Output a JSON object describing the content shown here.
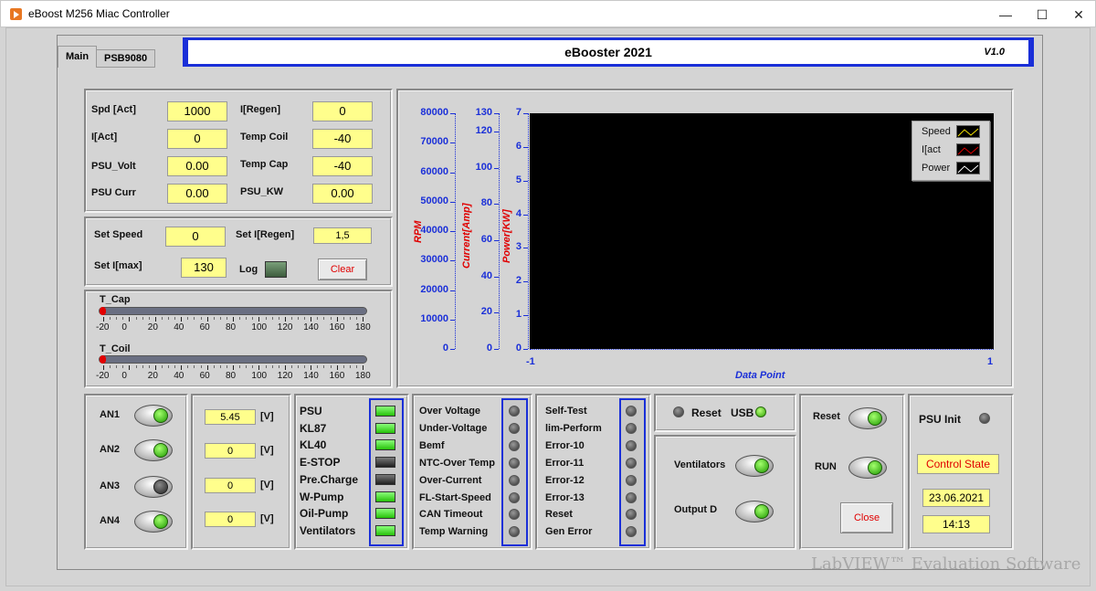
{
  "window": {
    "title": "eBoost M256 Miac Controller",
    "minimize": "—",
    "maximize": "☐",
    "close": "✕"
  },
  "tabs": [
    {
      "label": "Main"
    },
    {
      "label": "PSB9080"
    }
  ],
  "banner": {
    "title": "eBooster 2021",
    "version": "V1.0"
  },
  "readouts": {
    "spd_act": {
      "label": "Spd [Act]",
      "value": "1000"
    },
    "i_act": {
      "label": "I[Act]",
      "value": "0"
    },
    "psu_volt": {
      "label": "PSU_Volt",
      "value": "0.00"
    },
    "psu_curr": {
      "label": "PSU Curr",
      "value": "0.00"
    },
    "i_regen": {
      "label": "I[Regen]",
      "value": "0"
    },
    "temp_coil": {
      "label": "Temp Coil",
      "value": "-40"
    },
    "temp_cap": {
      "label": "Temp Cap",
      "value": "-40"
    },
    "psu_kw": {
      "label": "PSU_KW",
      "value": "0.00"
    }
  },
  "setpoints": {
    "set_speed": {
      "label": "Set Speed",
      "value": "0"
    },
    "set_i_max": {
      "label": "Set I[max]",
      "value": "130"
    },
    "set_i_regen": {
      "label": "Set I[Regen]",
      "value": "1,5"
    },
    "log_label": "Log",
    "clear_label": "Clear"
  },
  "sliders": {
    "t_cap": {
      "label": "T_Cap",
      "value": -20
    },
    "t_coil": {
      "label": "T_Coil",
      "value": -20
    },
    "scale": [
      "-20",
      "0",
      "20",
      "40",
      "60",
      "80",
      "100",
      "120",
      "140",
      "160",
      "180"
    ]
  },
  "chart_data": {
    "type": "line",
    "xlabel": "Data Point",
    "x_ticks": [
      "-1",
      "1"
    ],
    "xlim": [
      -1,
      1
    ],
    "axes": [
      {
        "title": "RPM",
        "ylim": [
          0,
          80000
        ],
        "ticks": [
          "80000",
          "70000",
          "60000",
          "50000",
          "40000",
          "30000",
          "20000",
          "10000",
          "0"
        ]
      },
      {
        "title": "Current[Amp]",
        "ylim": [
          0,
          130
        ],
        "ticks": [
          "130",
          "120",
          "100",
          "80",
          "60",
          "40",
          "20",
          "0"
        ]
      },
      {
        "title": "Power[KW]",
        "ylim": [
          0,
          7
        ],
        "ticks": [
          "7",
          "6",
          "5",
          "4",
          "3",
          "2",
          "1",
          "0"
        ]
      }
    ],
    "series": [
      {
        "name": "Speed",
        "values": [],
        "color": "#f5e400"
      },
      {
        "name": "I[act",
        "values": [],
        "color": "#e00000"
      },
      {
        "name": "Power",
        "values": [],
        "color": "#ffffff"
      }
    ]
  },
  "analog": {
    "switches": [
      {
        "label": "AN1"
      },
      {
        "label": "AN2"
      },
      {
        "label": "AN3"
      },
      {
        "label": "AN4"
      }
    ],
    "values": [
      {
        "value": "5.45",
        "unit": "[V]"
      },
      {
        "value": "0",
        "unit": "[V]"
      },
      {
        "value": "0",
        "unit": "[V]"
      },
      {
        "value": "0",
        "unit": "[V]"
      }
    ]
  },
  "power_indicators": [
    {
      "label": "PSU",
      "state": "on"
    },
    {
      "label": "KL87",
      "state": "on"
    },
    {
      "label": "KL40",
      "state": "on"
    },
    {
      "label": "E-STOP",
      "state": "off"
    },
    {
      "label": "Pre.Charge",
      "state": "off"
    },
    {
      "label": "W-Pump",
      "state": "on"
    },
    {
      "label": "Oil-Pump",
      "state": "on"
    },
    {
      "label": "Ventilators",
      "state": "on"
    }
  ],
  "faults": [
    "Over Voltage",
    "Under-Voltage",
    "Bemf",
    "NTC-Over Temp",
    "Over-Current",
    "FL-Start-Speed",
    "CAN Timeout",
    "Temp Warning"
  ],
  "errors": [
    "Self-Test",
    "lim-Perform",
    "Error-10",
    "Error-11",
    "Error-12",
    "Error-13",
    "Reset",
    "Gen Error"
  ],
  "status": {
    "reset_label": "Reset",
    "usb_label": "USB"
  },
  "outputs": {
    "ventilators_label": "Ventilators",
    "output_d_label": "Output D"
  },
  "run_control": {
    "reset_label": "Reset",
    "run_label": "RUN",
    "close_label": "Close"
  },
  "psu_panel": {
    "init_label": "PSU Init",
    "state": "Control State",
    "date": "23.06.2021",
    "time": "14:13"
  },
  "watermark": "LabVIEW™ Evaluation Software"
}
